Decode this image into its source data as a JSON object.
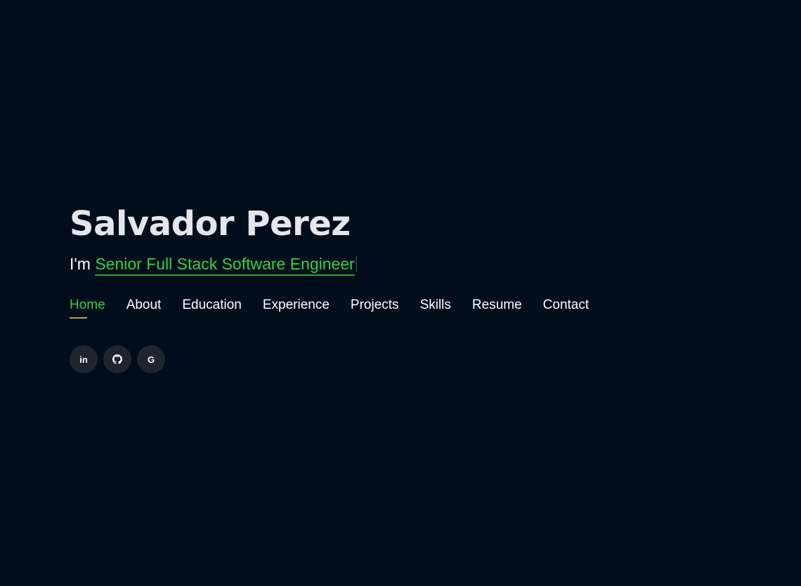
{
  "colors": {
    "background": "#010d1a",
    "accent": "#2fd24b",
    "nav_underline": "#c7a233",
    "social_bg": "#1e252f"
  },
  "hero": {
    "name": "Salvador Perez",
    "tagline_prefix": "I'm",
    "tagline_typed": "Senior Full Stack Software Engineer"
  },
  "nav": {
    "items": [
      {
        "label": "Home",
        "active": true
      },
      {
        "label": "About"
      },
      {
        "label": "Education"
      },
      {
        "label": "Experience"
      },
      {
        "label": "Projects"
      },
      {
        "label": "Skills"
      },
      {
        "label": "Resume"
      },
      {
        "label": "Contact"
      }
    ]
  },
  "socials": {
    "linkedin": {
      "icon": "linkedin-icon",
      "glyph": "in"
    },
    "github": {
      "icon": "github-icon"
    },
    "google": {
      "icon": "google-icon",
      "glyph": "G"
    }
  }
}
